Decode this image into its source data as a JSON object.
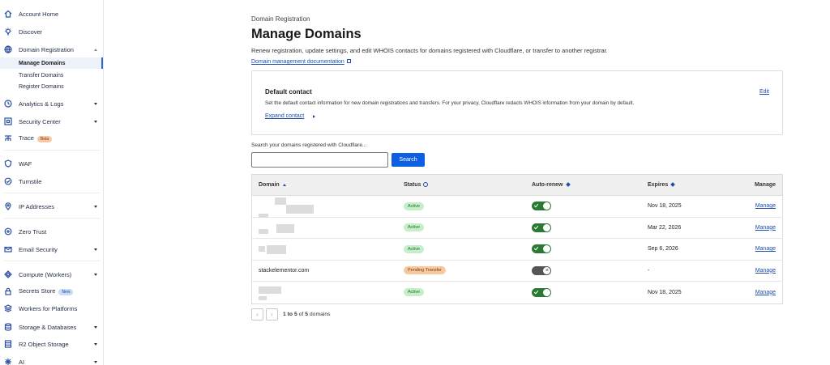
{
  "sidebar": {
    "items": [
      {
        "id": "account-home",
        "label": "Account Home",
        "icon": "home-icon"
      },
      {
        "id": "discover",
        "label": "Discover",
        "icon": "lightbulb-icon"
      },
      {
        "id": "domain-registration",
        "label": "Domain Registration",
        "icon": "globe-icon",
        "expanded": true,
        "children": [
          "Manage Domains",
          "Transfer Domains",
          "Register Domains"
        ]
      },
      {
        "id": "analytics-logs",
        "label": "Analytics & Logs",
        "icon": "clock-icon"
      },
      {
        "id": "security-center",
        "label": "Security Center",
        "icon": "shield-grid-icon"
      },
      {
        "id": "trace",
        "label": "Trace",
        "icon": "trace-icon",
        "badge": "Beta"
      },
      {
        "id": "waf",
        "label": "WAF",
        "icon": "shield-icon"
      },
      {
        "id": "turnstile",
        "label": "Turnstile",
        "icon": "turnstile-icon"
      },
      {
        "id": "ip-addresses",
        "label": "IP Addresses",
        "icon": "location-pin-icon"
      },
      {
        "id": "zero-trust",
        "label": "Zero Trust",
        "icon": "zero-trust-icon"
      },
      {
        "id": "email-security",
        "label": "Email Security",
        "icon": "email-icon"
      },
      {
        "id": "compute-workers",
        "label": "Compute (Workers)",
        "icon": "compute-icon"
      },
      {
        "id": "secrets-store",
        "label": "Secrets Store",
        "icon": "lock-icon",
        "badge": "New"
      },
      {
        "id": "workers-platforms",
        "label": "Workers for Platforms",
        "icon": "platforms-icon"
      },
      {
        "id": "storage-databases",
        "label": "Storage & Databases",
        "icon": "database-icon"
      },
      {
        "id": "r2-object-storage",
        "label": "R2 Object Storage",
        "icon": "storage-icon"
      },
      {
        "id": "ai",
        "label": "AI",
        "icon": "sparkle-icon"
      }
    ]
  },
  "page": {
    "breadcrumb": "Domain Registration",
    "title": "Manage Domains",
    "subtitle": "Renew registration, update settings, and edit WHOIS contacts for domains registered with Cloudflare, or transfer to another registrar.",
    "doc_link": "Domain management documentation"
  },
  "contact": {
    "title": "Default contact",
    "description": "Set the default contact information for new domain registrations and transfers. For your privacy, Cloudflare redacts WHOIS information from your domain by default.",
    "expand": "Expand contact",
    "edit": "Edit"
  },
  "search": {
    "label": "Search your domains registered with Cloudflare...",
    "value": "",
    "placeholder": "",
    "button": "Search"
  },
  "table": {
    "headers": {
      "domain": "Domain",
      "status": "Status",
      "autorenew": "Auto-renew",
      "expires": "Expires",
      "manage": "Manage"
    },
    "rows": [
      {
        "domain": "",
        "status": "Active",
        "autorenew": true,
        "expires": "Nov 18, 2025",
        "manage": "Manage"
      },
      {
        "domain": "",
        "status": "Active",
        "autorenew": true,
        "expires": "Mar 22, 2026",
        "manage": "Manage"
      },
      {
        "domain": "",
        "status": "Active",
        "autorenew": true,
        "expires": "Sep 6, 2026",
        "manage": "Manage"
      },
      {
        "domain": "stackelementor.com",
        "status": "Pending Transfer",
        "autorenew": false,
        "expires": "-",
        "manage": "Manage"
      },
      {
        "domain": "",
        "status": "Active",
        "autorenew": true,
        "expires": "Nov 18, 2025",
        "manage": "Manage"
      }
    ]
  },
  "pagination": {
    "range": "1 to 5",
    "of": "of",
    "total": "5",
    "unit": "domains"
  },
  "colors": {
    "primary": "#0b5fe0",
    "link": "#1c4fa8",
    "toggle_on": "#2b7a33",
    "active_badge": "#c5efc8",
    "pending_badge": "#f6c9a0"
  }
}
